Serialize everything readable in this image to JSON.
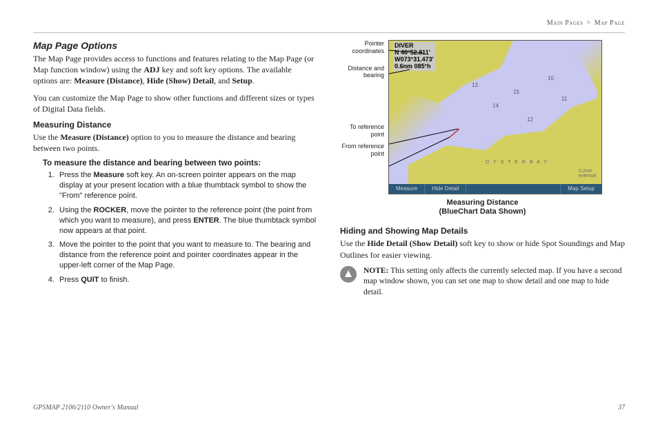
{
  "breadcrumb": {
    "parent": "Main Pages",
    "sep": ">",
    "current": "Map Page"
  },
  "left": {
    "heading": "Map Page Options",
    "intro_a": "The Map Page provides access to functions and features relating to the Map Page (or Map function window) using the ",
    "intro_adj": "ADJ",
    "intro_b": " key and soft key options. The available options are: ",
    "opt1": "Measure (Distance)",
    "opt2": "Hide (Show) Detail",
    "opt_and": ", and ",
    "opt3": "Setup",
    "intro_end": ".",
    "custom": "You can customize the Map Page to show other functions and different sizes or types of Digital Data fields.",
    "meas_head": "Measuring Distance",
    "meas_a": "Use the ",
    "meas_bold": "Measure (Distance)",
    "meas_b": " option to you to measure the distance and bearing between two points.",
    "proc_title": "To measure the distance and bearing between two points:",
    "steps": {
      "s1a": "Press the ",
      "s1_bold": "Measure",
      "s1b": " soft key. An on-screen pointer appears on the map display at your present location with a blue thumbtack symbol to show the \"From\" reference point.",
      "s2a": "Using the ",
      "s2_bold1": "ROCKER",
      "s2b": ", move the pointer to the reference point (the point from which you want to measure), and press ",
      "s2_bold2": "ENTER",
      "s2c": ". The blue thumbtack symbol now appears at that point.",
      "s3": "Move the pointer to the point that you want to measure to. The bearing and distance from the reference point and pointer coordinates appear in the upper-left corner of the Map Page.",
      "s4a": "Press ",
      "s4_bold": "QUIT",
      "s4b": " to finish."
    }
  },
  "right": {
    "labels": {
      "l1": "Pointer coordinates",
      "l2": "Distance and bearing",
      "l3": "To reference point",
      "l4": "From reference point"
    },
    "map_header": {
      "line1": "DIVER",
      "line2": "N  40°52.811'",
      "line3": "W073°31.473'",
      "line4": "0.6nm    085°h"
    },
    "map_softkeys": {
      "k1": "Measure",
      "k2": "Hide Detail",
      "k3": "Map Setup"
    },
    "map_place": "O Y S T E R B A Y",
    "caption_l1": "Measuring Distance",
    "caption_l2": "(BlueChart Data Shown)",
    "hide_head": "Hiding and Showing Map Details",
    "hide_a": "Use the ",
    "hide_bold": "Hide Detail (Show Detail)",
    "hide_b": " soft key to show or hide Spot Soundings and Map Outlines for easier viewing.",
    "note_label": "NOTE:",
    "note_text": " This setting only affects the currently selected map. If you have a second map window shown, you can set one map to show detail and one map to hide detail."
  },
  "footer": {
    "left": "GPSMAP 2106/2110 Owner's Manual",
    "right": "37"
  }
}
